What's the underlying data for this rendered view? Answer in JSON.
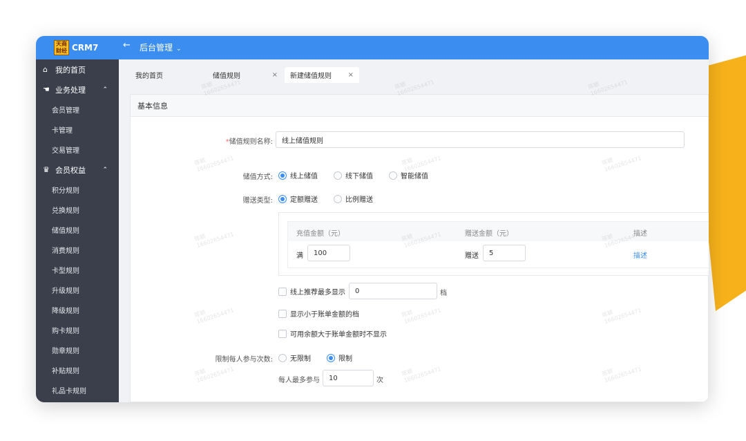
{
  "app": {
    "name": "CRM7",
    "logo_text": "天商财经"
  },
  "topbar": {
    "back_icon": "arrow-left-icon",
    "title": "后台管理"
  },
  "sidebar": {
    "groups": [
      {
        "label": "我的首页",
        "icon": "home-icon"
      },
      {
        "label": "业务处理",
        "icon": "hand-icon"
      },
      {
        "label": "会员权益",
        "icon": "crown-icon"
      }
    ],
    "business_items": [
      "会员管理",
      "卡管理",
      "交易管理"
    ],
    "benefit_items": [
      "积分规则",
      "兑换规则",
      "储值规则",
      "消费规则",
      "卡型规则",
      "升级规则",
      "降级规则",
      "购卡规则",
      "勋章规则",
      "补贴规则",
      "礼品卡规则"
    ]
  },
  "tabs": [
    "我的首页",
    "储值规则",
    "新建储值规则"
  ],
  "panel": {
    "title": "基本信息",
    "name_label": "储值规则名称:",
    "name_value": "线上储值规则",
    "method_label": "储值方式:",
    "method_options": [
      "线上储值",
      "线下储值",
      "智能储值"
    ],
    "method_selected": "线上储值",
    "gift_label": "赠送类型:",
    "gift_options": [
      "定额赠送",
      "比例赠送"
    ],
    "gift_selected": "定额赠送",
    "table": {
      "headers": [
        "充值金额（元）",
        "赠送金额（元）",
        "描述"
      ],
      "row": {
        "full_label": "满",
        "recharge": "100",
        "gift_label": "赠送",
        "gift": "5",
        "desc_link": "描述"
      }
    },
    "recommend_label": "线上推荐最多显示",
    "recommend_value": "0",
    "recommend_unit": "档",
    "show_smaller_label": "显示小于账单金额的档",
    "hide_when_label": "可用余额大于账单金额时不显示",
    "limit_label": "限制每人参与次数:",
    "limit_options": [
      "无限制",
      "限制"
    ],
    "limit_selected": "限制",
    "max_label": "每人最多参与",
    "max_value": "10",
    "max_unit": "次"
  },
  "watermark": {
    "name": "陈颖",
    "phone": "16602654471"
  },
  "colors": {
    "primary": "#3b8ef0",
    "sidebar": "#3a3f4b",
    "accent_deco": "#f7b21b"
  }
}
